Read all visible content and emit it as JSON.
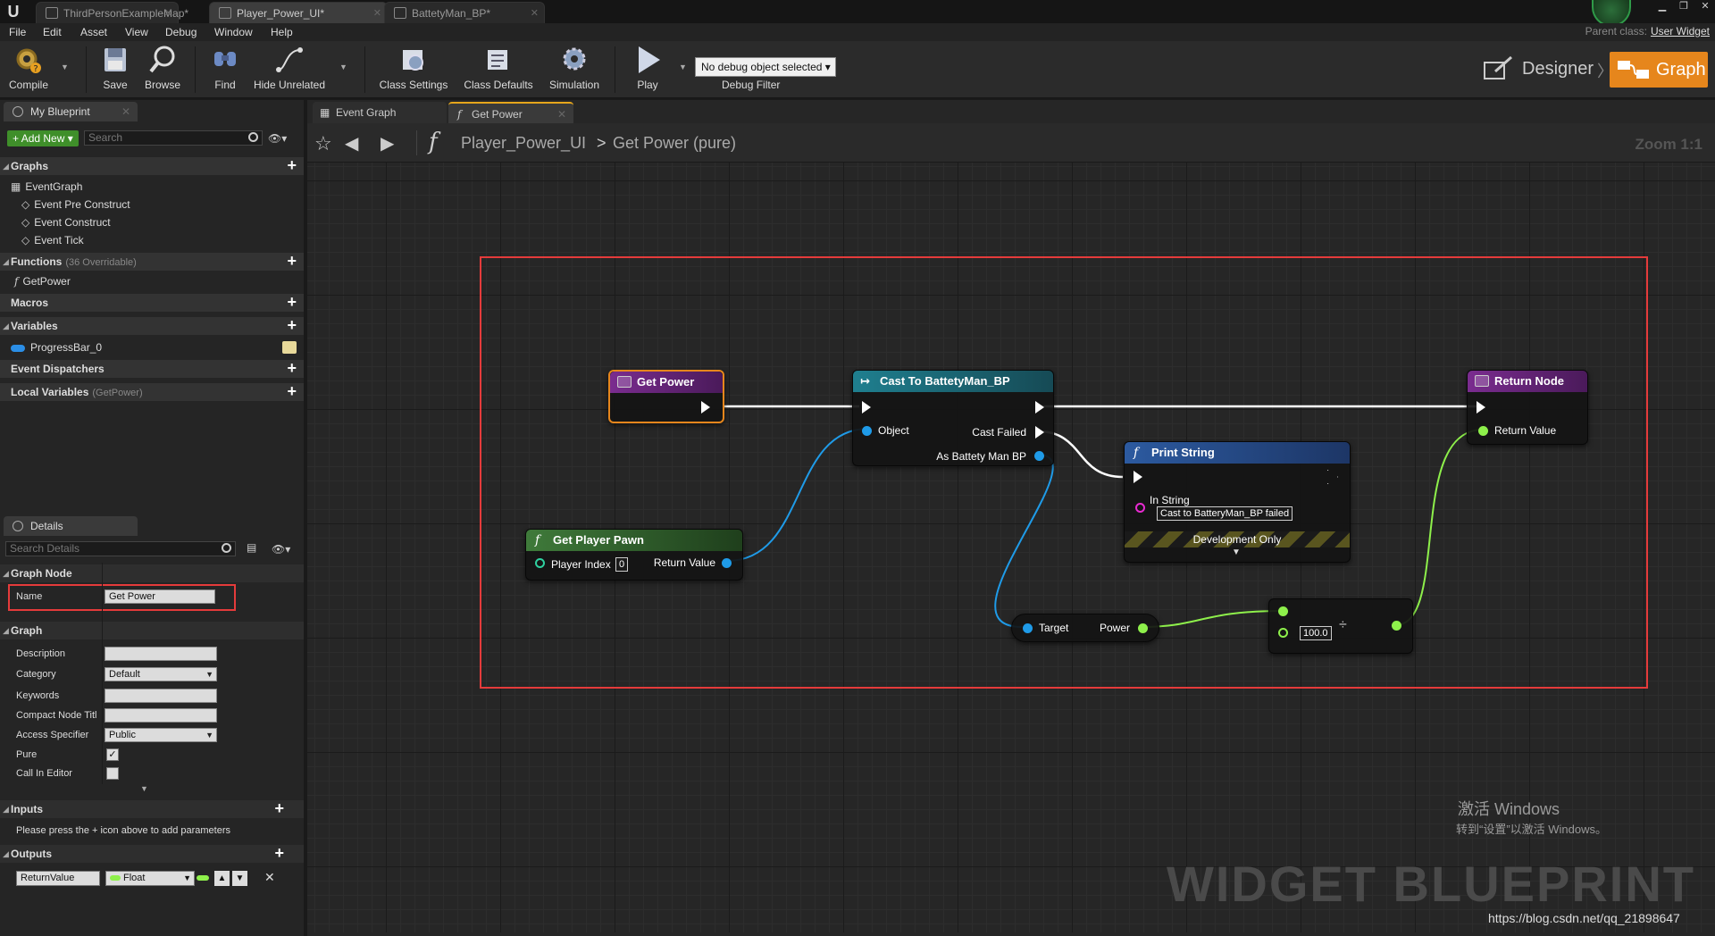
{
  "doc_tabs": [
    {
      "label": "ThirdPersonExampleMap*"
    },
    {
      "label": "Player_Power_UI*"
    },
    {
      "label": "BattetyMan_BP*"
    }
  ],
  "menu": [
    "File",
    "Edit",
    "Asset",
    "View",
    "Debug",
    "Window",
    "Help"
  ],
  "parent_class": {
    "label": "Parent class:",
    "value": "User Widget"
  },
  "toolbar": {
    "compile": "Compile",
    "save": "Save",
    "browse": "Browse",
    "find": "Find",
    "hide_unrelated": "Hide Unrelated",
    "class_settings": "Class Settings",
    "class_defaults": "Class Defaults",
    "simulation": "Simulation",
    "play": "Play",
    "debug_select": "No debug object selected",
    "debug_filter": "Debug Filter",
    "designer": "Designer",
    "graph": "Graph"
  },
  "my_blueprint": {
    "tab": "My Blueprint",
    "add_new": "Add New",
    "search_placeholder": "Search",
    "graphs": "Graphs",
    "event_graph": "EventGraph",
    "events": [
      "Event Pre Construct",
      "Event Construct",
      "Event Tick"
    ],
    "functions": "Functions",
    "functions_sub": "(36 Overridable)",
    "function_items": [
      "GetPower"
    ],
    "macros": "Macros",
    "variables": "Variables",
    "variable_items": [
      "ProgressBar_0"
    ],
    "event_dispatchers": "Event Dispatchers",
    "local_variables": "Local Variables",
    "local_variables_sub": "(GetPower)"
  },
  "details": {
    "tab": "Details",
    "search_placeholder": "Search Details",
    "graph_node": "Graph Node",
    "name_label": "Name",
    "name_value": "Get Power",
    "graph": "Graph",
    "description_label": "Description",
    "description_value": "",
    "category_label": "Category",
    "category_value": "Default",
    "keywords_label": "Keywords",
    "keywords_value": "",
    "compact_label": "Compact Node Titl",
    "compact_value": "",
    "access_label": "Access Specifier",
    "access_value": "Public",
    "pure_label": "Pure",
    "pure_checked": "✓",
    "call_in_editor_label": "Call In Editor",
    "inputs": "Inputs",
    "inputs_hint": "Please press the + icon above to add parameters",
    "outputs": "Outputs",
    "output_name": "ReturnValue",
    "output_type": "Float"
  },
  "graph_tabs": [
    {
      "label": "Event Graph"
    },
    {
      "label": "Get Power"
    }
  ],
  "breadcrumb": {
    "blueprint": "Player_Power_UI",
    "sep": ">",
    "function": "Get Power (pure)"
  },
  "zoom": "Zoom 1:1",
  "nodes": {
    "get_power": {
      "title": "Get Power"
    },
    "cast": {
      "title": "Cast To BattetyMan_BP",
      "object": "Object",
      "cast_failed": "Cast Failed",
      "as_bp": "As Battety Man BP"
    },
    "print_string": {
      "title": "Print String",
      "in_string": "In String",
      "in_string_value": "Cast to BatteryMan_BP failed",
      "dev_only": "Development Only"
    },
    "get_player_pawn": {
      "title": "Get Player Pawn",
      "player_index": "Player Index",
      "player_index_value": "0",
      "return_value": "Return Value"
    },
    "get_power_var": {
      "target": "Target",
      "power": "Power"
    },
    "divide": {
      "b_value": "100.0",
      "op": "÷"
    },
    "return_node": {
      "title": "Return Node",
      "return_value": "Return Value"
    }
  },
  "colors": {
    "accent": "#e6861c",
    "exec": "#ffffff",
    "object_pin": "#1f9be8",
    "float_pin": "#8ef04b",
    "string_pin": "#e82bd1",
    "highlight": "#e53b3b"
  },
  "watermark": "WIDGET BLUEPRINT",
  "windows_activation": {
    "line1": "激活 Windows",
    "line2": "转到“设置”以激活 Windows。"
  },
  "url": "https://blog.csdn.net/qq_21898647"
}
